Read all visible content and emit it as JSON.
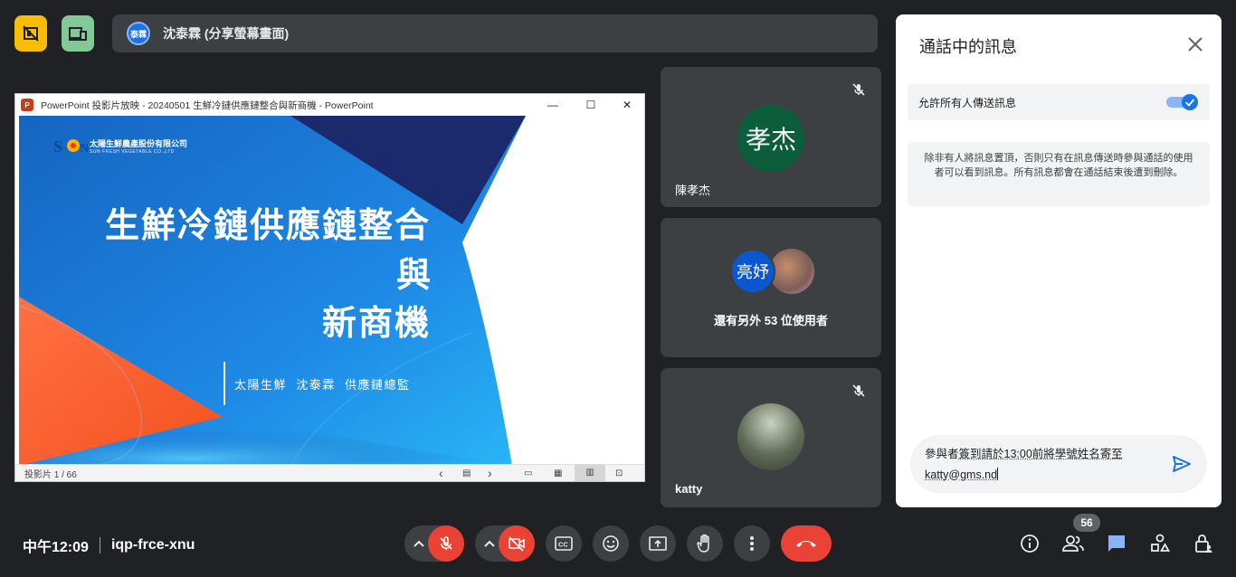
{
  "presenter": {
    "avatar_text": "泰霖",
    "label": "沈泰霖 (分享螢幕畫面)"
  },
  "ppt": {
    "window_title": "PowerPoint 投影片放映  -  20240501 生鮮冷鏈供應鏈整合與新商機 - PowerPoint",
    "app_icon": "P",
    "company_cn": "太陽生鮮農產股份有限公司",
    "company_en": "SUN FRESH VEGETABLE CO.,LTD",
    "logo_text": "SUN",
    "slide_title_1": "生鮮冷鏈供應鏈整合",
    "slide_title_2": "與",
    "slide_title_3": "新商機",
    "subtitle": "太陽生鮮  沈泰霖  供應鏈總監",
    "status": "投影片 1 / 66"
  },
  "tiles": {
    "t1_avatar": "孝杰",
    "t1_name": "陳孝杰",
    "t2_avatar": "亮妤",
    "t2_text": "還有另外 53 位使用者",
    "t3_name": "katty"
  },
  "panel": {
    "title": "通話中的訊息",
    "allow_label": "允許所有人傳送訊息",
    "allow_on": true,
    "note": "除非有人將訊息置頂，否則只有在訊息傳送時參與通話的使用者可以看到訊息。所有訊息都會在通話結束後遭到刪除。",
    "compose_a": "參與者",
    "compose_b": "簽到請於",
    "compose_c": "13:00前將學號姓名寄至",
    "compose_d": "katty@gms.nd"
  },
  "bottom": {
    "time": "中午12:09",
    "meeting_code": "iqp-frce-xnu",
    "participants_count": "56"
  },
  "colors": {
    "hangup": "#ea4335",
    "accent": "#1a73e8",
    "chat_icon": "#8ab4f8",
    "bg": "#202124"
  }
}
